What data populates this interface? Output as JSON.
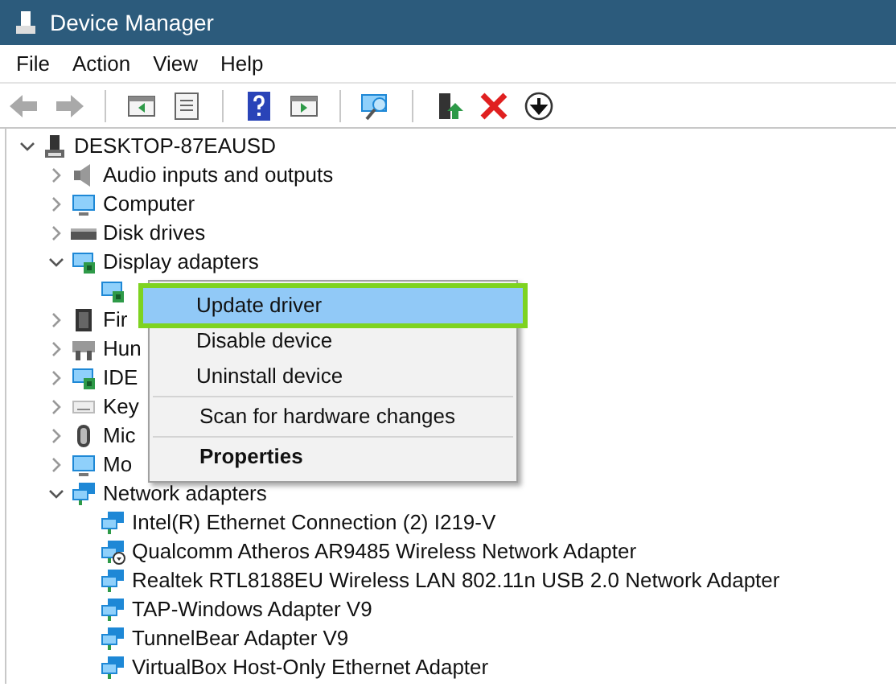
{
  "window": {
    "title": "Device Manager"
  },
  "menu": [
    "File",
    "Action",
    "View",
    "Help"
  ],
  "toolbar": [
    {
      "kind": "back",
      "disabled": true
    },
    {
      "kind": "forward",
      "disabled": true
    },
    {
      "kind": "separator"
    },
    {
      "kind": "tree",
      "disabled": false
    },
    {
      "kind": "sheet",
      "disabled": false
    },
    {
      "kind": "separator"
    },
    {
      "kind": "help",
      "disabled": false
    },
    {
      "kind": "pane",
      "disabled": false
    },
    {
      "kind": "separator"
    },
    {
      "kind": "scan",
      "disabled": false
    },
    {
      "kind": "separator"
    },
    {
      "kind": "update",
      "disabled": false
    },
    {
      "kind": "remove",
      "disabled": false
    },
    {
      "kind": "download",
      "disabled": false
    }
  ],
  "tree": {
    "label": "DESKTOP-87EAUSD",
    "kind": "computer",
    "expanded": true,
    "children": [
      {
        "label": "Audio inputs and outputs",
        "kind": "audio",
        "expanded": false
      },
      {
        "label": "Computer",
        "kind": "monitor",
        "expanded": false
      },
      {
        "label": "Disk drives",
        "kind": "disk",
        "expanded": false
      },
      {
        "label": "Display adapters",
        "kind": "display",
        "expanded": true,
        "children": [
          {
            "kind": "display"
          }
        ]
      },
      {
        "label": "Fir",
        "kind": "chip",
        "expanded": false
      },
      {
        "label": "Hun",
        "kind": "hid",
        "expanded": false
      },
      {
        "label": "IDE",
        "kind": "display",
        "expanded": false
      },
      {
        "label": "Key",
        "kind": "keyboard",
        "expanded": false
      },
      {
        "label": "Mic",
        "kind": "mouse",
        "expanded": false
      },
      {
        "label": "Mo",
        "kind": "monitor",
        "expanded": false
      },
      {
        "label": "Network adapters",
        "kind": "network",
        "expanded": true,
        "children": [
          {
            "label": "Intel(R) Ethernet Connection (2) I219-V",
            "kind": "network"
          },
          {
            "label": "Qualcomm Atheros AR9485 Wireless Network Adapter",
            "kind": "network-down"
          },
          {
            "label": "Realtek RTL8188EU Wireless LAN 802.11n USB 2.0 Network Adapter",
            "kind": "network"
          },
          {
            "label": "TAP-Windows Adapter V9",
            "kind": "network"
          },
          {
            "label": "TunnelBear Adapter V9",
            "kind": "network"
          },
          {
            "label": "VirtualBox Host-Only Ethernet Adapter",
            "kind": "network"
          }
        ]
      }
    ]
  },
  "context_menu": {
    "groups": [
      [
        {
          "label": "Update driver",
          "selected": true,
          "default": false
        },
        {
          "label": "Disable device",
          "selected": false,
          "default": false
        },
        {
          "label": "Uninstall device",
          "selected": false,
          "default": false
        }
      ],
      [
        {
          "label": "Scan for hardware changes",
          "selected": false,
          "default": false
        }
      ],
      [
        {
          "label": "Properties",
          "selected": false,
          "default": true
        }
      ]
    ]
  }
}
